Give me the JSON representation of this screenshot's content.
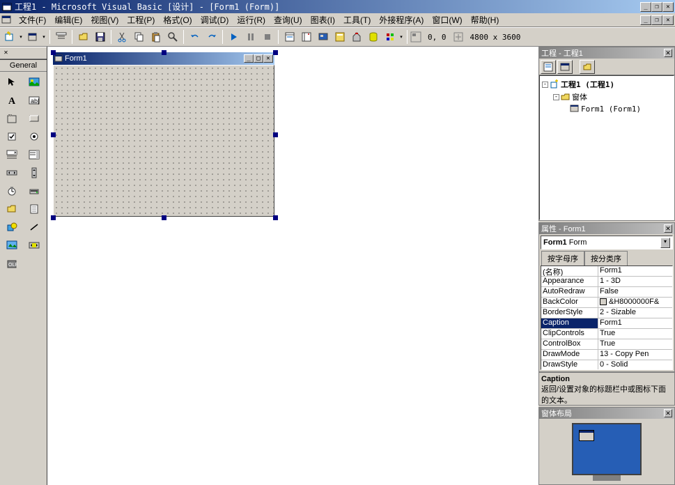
{
  "app": {
    "title": "工程1 - Microsoft Visual Basic [设计] - [Form1 (Form)]"
  },
  "menu": {
    "file": "文件(F)",
    "edit": "编辑(E)",
    "view": "视图(V)",
    "project": "工程(P)",
    "format": "格式(O)",
    "debug": "调试(D)",
    "run": "运行(R)",
    "query": "查询(U)",
    "diagram": "图表(I)",
    "tools": "工具(T)",
    "addins": "外接程序(A)",
    "window": "窗口(W)",
    "help": "帮助(H)"
  },
  "toolbar": {
    "pos": "0, 0",
    "size": "4800 x 3600"
  },
  "toolbox": {
    "title": "General"
  },
  "form": {
    "caption": "Form1"
  },
  "project_panel": {
    "title": "工程 - 工程1",
    "root": "工程1 (工程1)",
    "folder": "窗体",
    "item": "Form1 (Form1)"
  },
  "props_panel": {
    "title": "属性 - Form1",
    "object_name": "Form1",
    "object_type": "Form",
    "tab_alpha": "按字母序",
    "tab_cat": "按分类序",
    "rows": [
      {
        "name": "(名称)",
        "value": "Form1"
      },
      {
        "name": "Appearance",
        "value": "1 - 3D"
      },
      {
        "name": "AutoRedraw",
        "value": "False"
      },
      {
        "name": "BackColor",
        "value": "&H8000000F&"
      },
      {
        "name": "BorderStyle",
        "value": "2 - Sizable"
      },
      {
        "name": "Caption",
        "value": "Form1",
        "selected": true
      },
      {
        "name": "ClipControls",
        "value": "True"
      },
      {
        "name": "ControlBox",
        "value": "True"
      },
      {
        "name": "DrawMode",
        "value": "13 - Copy Pen"
      },
      {
        "name": "DrawStyle",
        "value": "0 - Solid"
      }
    ]
  },
  "desc": {
    "title": "Caption",
    "text": "返回/设置对象的标题栏中或图标下面的文本。"
  },
  "layout_panel": {
    "title": "窗体布局"
  }
}
